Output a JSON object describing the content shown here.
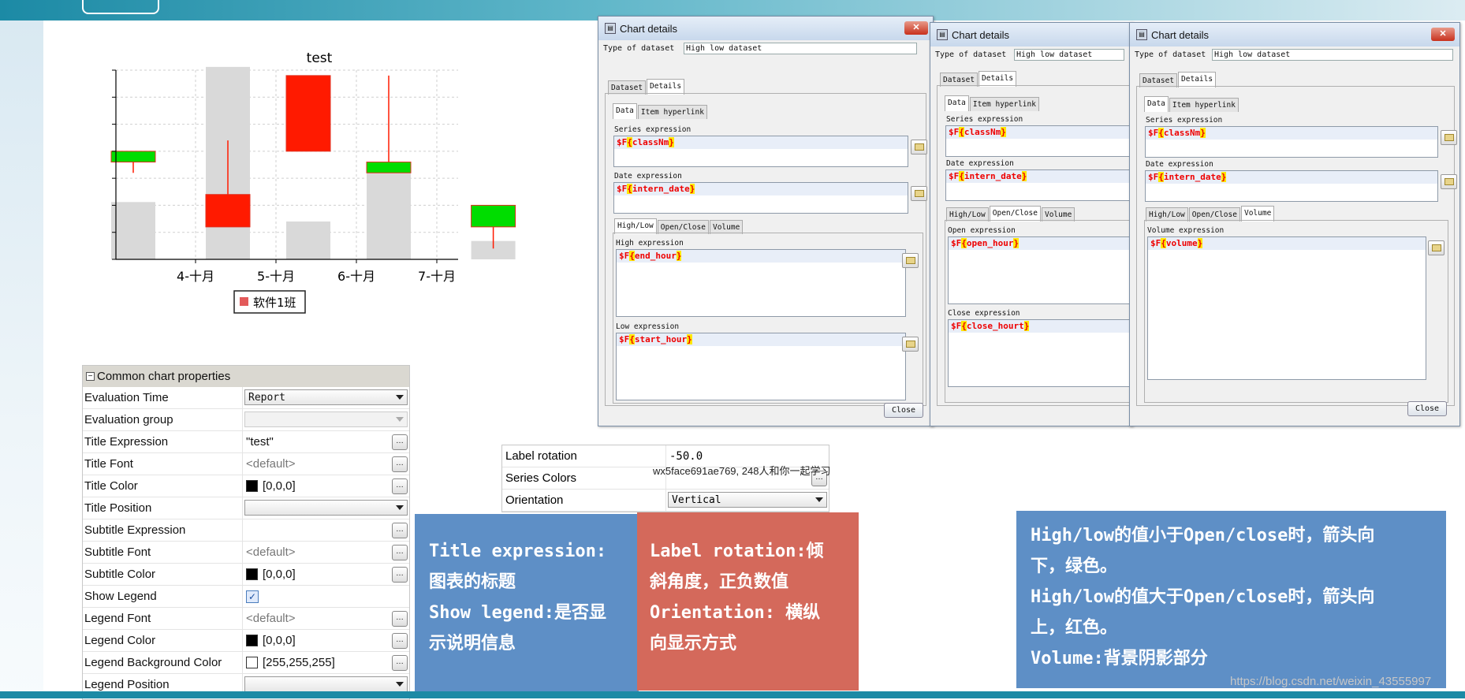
{
  "chart_data": {
    "type": "candlestick",
    "title": "test",
    "categories": [
      "4-十月",
      "5-十月",
      "6-十月",
      "7-十月"
    ],
    "y_ticks": [
      "0.0",
      "2.5",
      "5.0",
      "7.5",
      "10.0",
      "12.5",
      "15.0",
      "17.5"
    ],
    "ylim": [
      0,
      17.5
    ],
    "legend": "软件1班",
    "colors": {
      "up": "#00dd00",
      "down": "#ff1a00",
      "volume": "#d9d9d9",
      "wick": "#ff1a00"
    },
    "candles": [
      {
        "day": 0,
        "open": 10.0,
        "close": 9.0,
        "high": 10.0,
        "low": 8.0,
        "volume": 5.3
      },
      {
        "day": 1,
        "open": 3.0,
        "close": 6.0,
        "high": 11.0,
        "low": 3.0,
        "volume": 17.8
      },
      {
        "day": 2,
        "open": 10.0,
        "close": 17.0,
        "high": 17.0,
        "low": 10.0,
        "volume": 3.5
      },
      {
        "day": 3,
        "open": 9.0,
        "close": 8.0,
        "high": 17.0,
        "low": 8.0,
        "volume": 8.0
      },
      {
        "day": 4.3,
        "open": 5.0,
        "close": 3.0,
        "high": 5.0,
        "low": 1.0,
        "volume": 1.7
      }
    ]
  },
  "props": {
    "header": "Common chart properties",
    "rows": [
      {
        "label": "Evaluation Time",
        "value": "Report"
      },
      {
        "label": "Evaluation group",
        "value": ""
      },
      {
        "label": "Title Expression",
        "value": "\"test\""
      },
      {
        "label": "Title Font",
        "value": "<default>"
      },
      {
        "label": "Title Color",
        "value": "[0,0,0]"
      },
      {
        "label": "Title Position",
        "value": ""
      },
      {
        "label": "Subtitle Expression",
        "value": ""
      },
      {
        "label": "Subtitle Font",
        "value": "<default>"
      },
      {
        "label": "Subtitle Color",
        "value": "[0,0,0]"
      },
      {
        "label": "Show Legend",
        "value": "✓"
      },
      {
        "label": "Legend Font",
        "value": "<default>"
      },
      {
        "label": "Legend Color",
        "value": "[0,0,0]"
      },
      {
        "label": "Legend Background Color",
        "value": "[255,255,255]"
      },
      {
        "label": "Legend Position",
        "value": ""
      }
    ]
  },
  "dialogs": {
    "title": "Chart details",
    "type_label": "Type of dataset",
    "type_value": "High low dataset",
    "tab_dataset": "Dataset",
    "tab_details": "Details",
    "tab_data": "Data",
    "tab_hyperlink": "Item hyperlink",
    "series_label": "Series expression",
    "series_value": "classNm",
    "date_label": "Date expression",
    "date_value": "intern_date",
    "tab_highlow": "High/Low",
    "tab_openclose": "Open/Close",
    "tab_volume": "Volume",
    "high_label": "High expression",
    "high_value": "end_hour",
    "low_label": "Low expression",
    "low_value": "start_hour",
    "open_label": "Open expression",
    "open_value": "open_hour",
    "closeexp_label": "Close expression",
    "closeexp_value": "close_hourt",
    "volume_label": "Volume expression",
    "volume_value": "volume",
    "close_button": "Close",
    "field_prefix": "$F"
  },
  "mini": {
    "label_rotation": "Label rotation",
    "label_rotation_value": "-50.0",
    "series_colors": "Series Colors",
    "orientation": "Orientation",
    "orientation_value": "Vertical"
  },
  "watermark1": "wx5face691ae769, 248人和你一起学习",
  "notes": {
    "n1": [
      "Title expression:",
      "图表的标题",
      "Show legend:是否显",
      "示说明信息"
    ],
    "n2": [
      "Label rotation:倾",
      "斜角度，正负数值",
      "Orientation: 横纵",
      "向显示方式"
    ],
    "n3": [
      "High/low的值小于Open/close时，箭头向",
      "下，绿色。",
      "High/low的值大于Open/close时，箭头向",
      "上，红色。",
      "Volume:背景阴影部分"
    ]
  },
  "watermark2": "https://blog.csdn.net/weixin_43555997"
}
